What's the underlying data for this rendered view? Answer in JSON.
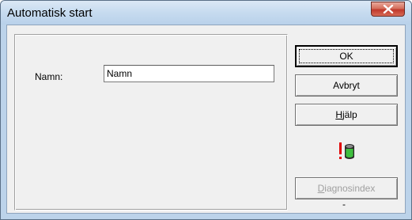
{
  "window": {
    "title": "Automatisk start",
    "close_icon": "close-icon"
  },
  "form": {
    "name_label": "Namn:",
    "name_value": "Namn"
  },
  "buttons": {
    "ok": "OK",
    "cancel": "Avbryt",
    "help_mnemonic": "H",
    "help_rest": "jälp",
    "diagnostics_mnemonic": "D",
    "diagnostics_rest": "iagnosindex"
  },
  "status": {
    "icon": "warning-db-icon",
    "value": "-"
  },
  "colors": {
    "titlebar": "#c6dbef",
    "close_button": "#c0392b",
    "dialog_bg": "#f0f0f0",
    "warning_red": "#e00000",
    "db_green": "#3fbf3f"
  }
}
